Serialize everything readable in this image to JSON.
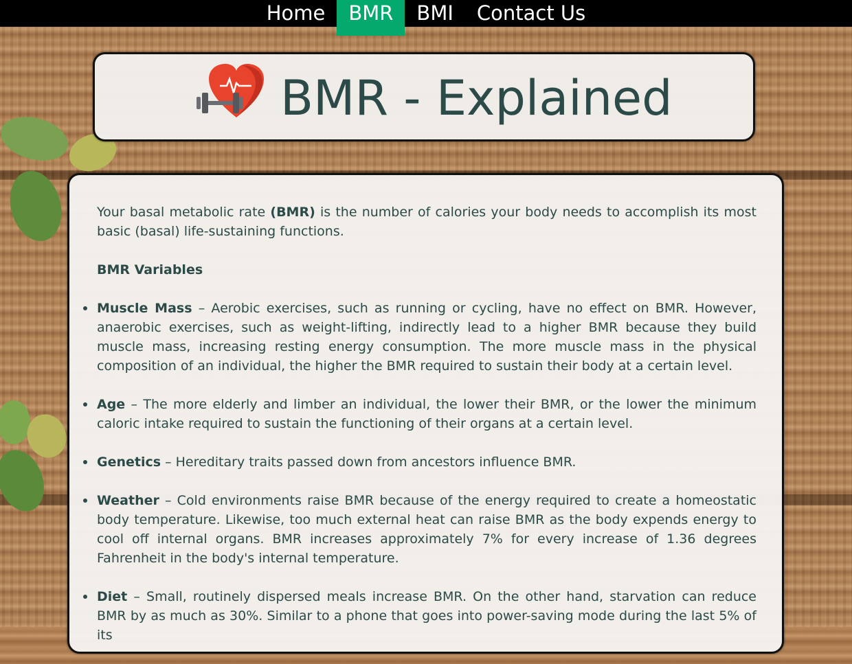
{
  "nav": {
    "items": [
      "Home",
      "BMR",
      "BMI",
      "Contact Us"
    ],
    "active": "BMR"
  },
  "header": {
    "title": "BMR - Explained",
    "icon": "heart-dumbbell-icon"
  },
  "content": {
    "intro_before": "Your basal metabolic rate ",
    "intro_bold": "(BMR)",
    "intro_after": " is the number of calories your body needs to accomplish its most basic (basal) life-sustaining functions.",
    "variables_heading": "BMR Variables",
    "variables": [
      {
        "term": "Muscle Mass",
        "desc": " – Aerobic exercises, such as running or cycling, have no effect on BMR. However, anaerobic exercises, such as weight-lifting, indirectly lead to a higher BMR because they build muscle mass, increasing resting energy consumption. The more muscle mass in the physical composition of an individual, the higher the BMR required to sustain their body at a certain level."
      },
      {
        "term": "Age",
        "desc": " – The more elderly and limber an individual, the lower their BMR, or the lower the minimum caloric intake required to sustain the functioning of their organs at a certain level."
      },
      {
        "term": "Genetics",
        "desc": " – Hereditary traits passed down from ancestors influence BMR."
      },
      {
        "term": "Weather",
        "desc": " – Cold environments raise BMR because of the energy required to create a homeostatic body temperature. Likewise, too much external heat can raise BMR as the body expends energy to cool off internal organs. BMR increases approximately 7% for every increase of 1.36 degrees Fahrenheit in the body's internal temperature."
      },
      {
        "term": "Diet",
        "desc": " – Small, routinely dispersed meals increase BMR. On the other hand, starvation can reduce BMR by as much as 30%. Similar to a phone that goes into power-saving mode during the last 5% of its"
      }
    ]
  },
  "colors": {
    "nav_bg": "#000000",
    "nav_active": "#04aa6d",
    "text": "#2b4a48",
    "card_bg": "#f4f2ef",
    "heart": "#e8432c"
  }
}
